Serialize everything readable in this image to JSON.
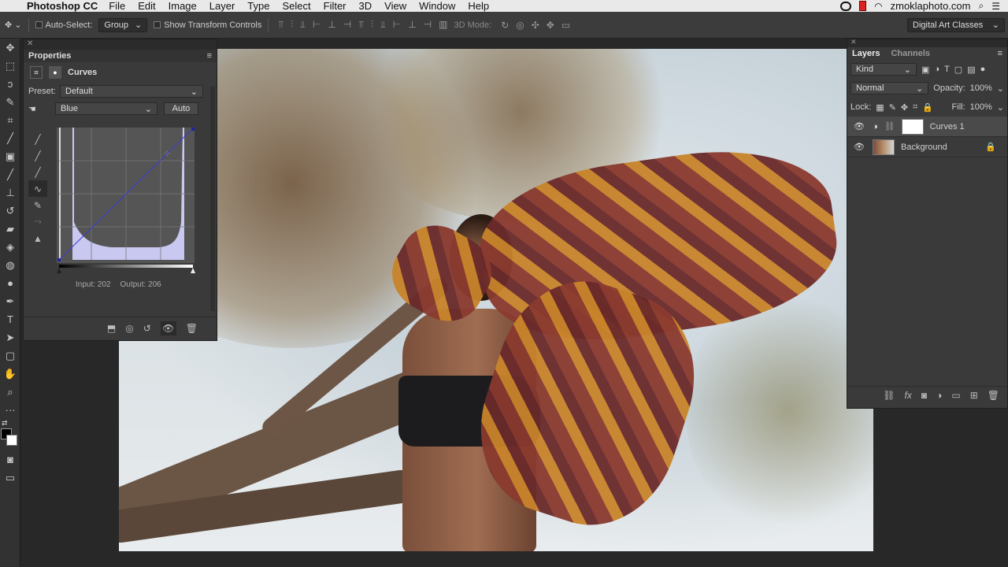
{
  "menubar": {
    "app": "Photoshop CC",
    "items": [
      "File",
      "Edit",
      "Image",
      "Layer",
      "Type",
      "Select",
      "Filter",
      "3D",
      "View",
      "Window",
      "Help"
    ],
    "site": "zmoklaphoto.com"
  },
  "options": {
    "auto_select_label": "Auto-Select:",
    "auto_select_value": "Group",
    "transform_label": "Show Transform Controls",
    "mode_3d": "3D Mode:",
    "workspace": "Digital Art Classes"
  },
  "properties": {
    "panel_title": "Properties",
    "adjustment": "Curves",
    "preset_label": "Preset:",
    "preset_value": "Default",
    "channel": "Blue",
    "auto_label": "Auto",
    "input_label": "Input: 202",
    "output_label": "Output: 206"
  },
  "layers": {
    "tab_layers": "Layers",
    "tab_channels": "Channels",
    "kind": "Kind",
    "blend_mode": "Normal",
    "opacity_label": "Opacity:",
    "opacity_value": "100%",
    "lock_label": "Lock:",
    "fill_label": "Fill:",
    "fill_value": "100%",
    "items": [
      {
        "name": "Curves 1",
        "selected": true
      },
      {
        "name": "Background",
        "selected": false
      }
    ]
  }
}
